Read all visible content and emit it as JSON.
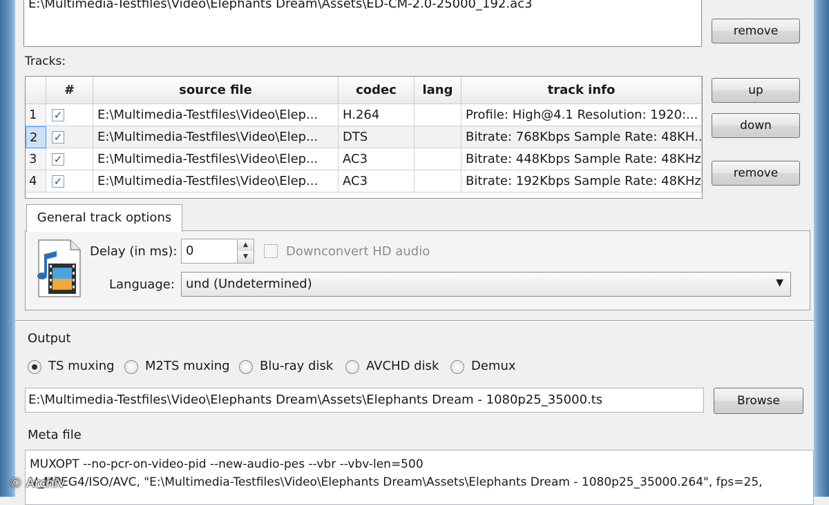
{
  "input_files": {
    "last_visible_path": "E:\\Multimedia-Testfiles\\Video\\Elephants Dream\\Assets\\ED-CM-2.0-25000_192.ac3",
    "remove_label": "remove"
  },
  "tracks": {
    "label": "Tracks:",
    "columns": [
      "#",
      "source file",
      "codec",
      "lang",
      "track info"
    ],
    "rows": [
      {
        "num": "1",
        "checked": true,
        "source": "E:\\Multimedia-Testfiles\\Video\\Elep...",
        "codec": "H.264",
        "lang": "",
        "info": "Profile: High@4.1  Resolution: 1920:..."
      },
      {
        "num": "2",
        "checked": true,
        "source": "E:\\Multimedia-Testfiles\\Video\\Elep...",
        "codec": "DTS",
        "lang": "",
        "info": "Bitrate: 768Kbps  Sample Rate: 48KH..."
      },
      {
        "num": "3",
        "checked": true,
        "source": "E:\\Multimedia-Testfiles\\Video\\Elep...",
        "codec": "AC3",
        "lang": "",
        "info": "Bitrate: 448Kbps Sample Rate: 48KHz..."
      },
      {
        "num": "4",
        "checked": true,
        "source": "E:\\Multimedia-Testfiles\\Video\\Elep...",
        "codec": "AC3",
        "lang": "",
        "info": "Bitrate: 192Kbps Sample Rate: 48KHz..."
      }
    ],
    "selected_row": 2,
    "up_label": "up",
    "down_label": "down",
    "remove_label": "remove"
  },
  "track_options": {
    "tab_label": "General track options",
    "delay_label": "Delay (in ms):",
    "delay_value": "0",
    "downconvert_label": "Downconvert HD audio",
    "downconvert_checked": false,
    "language_label": "Language:",
    "language_value": "und (Undetermined)"
  },
  "output": {
    "label": "Output",
    "options": [
      "TS muxing",
      "M2TS muxing",
      "Blu-ray disk",
      "AVCHD disk",
      "Demux"
    ],
    "selected": "TS muxing",
    "file_path": "E:\\Multimedia-Testfiles\\Video\\Elephants Dream\\Assets\\Elephants Dream - 1080p25_35000.ts",
    "browse_label": "Browse"
  },
  "meta": {
    "label": "Meta file",
    "line1": "MUXOPT --no-pcr-on-video-pid --new-audio-pes --vbr  --vbv-len=500",
    "line2": "V_MPEG4/ISO/AVC, \"E:\\Multimedia-Testfiles\\Video\\Elephants Dream\\Assets\\Elephants Dream - 1080p25_35000.264\", fps=25,"
  },
  "watermark": "© Archiv",
  "icons": {
    "media_file": "media-file-icon",
    "checkbox": "checkbox-check-icon",
    "spin_up": "spin-up-icon",
    "spin_down": "spin-down-icon",
    "dropdown": "chevron-down-icon"
  },
  "colors": {
    "window_frame": "#6f9fca",
    "selection": "#cde0f5",
    "checkmark": "#1c4a8e"
  }
}
